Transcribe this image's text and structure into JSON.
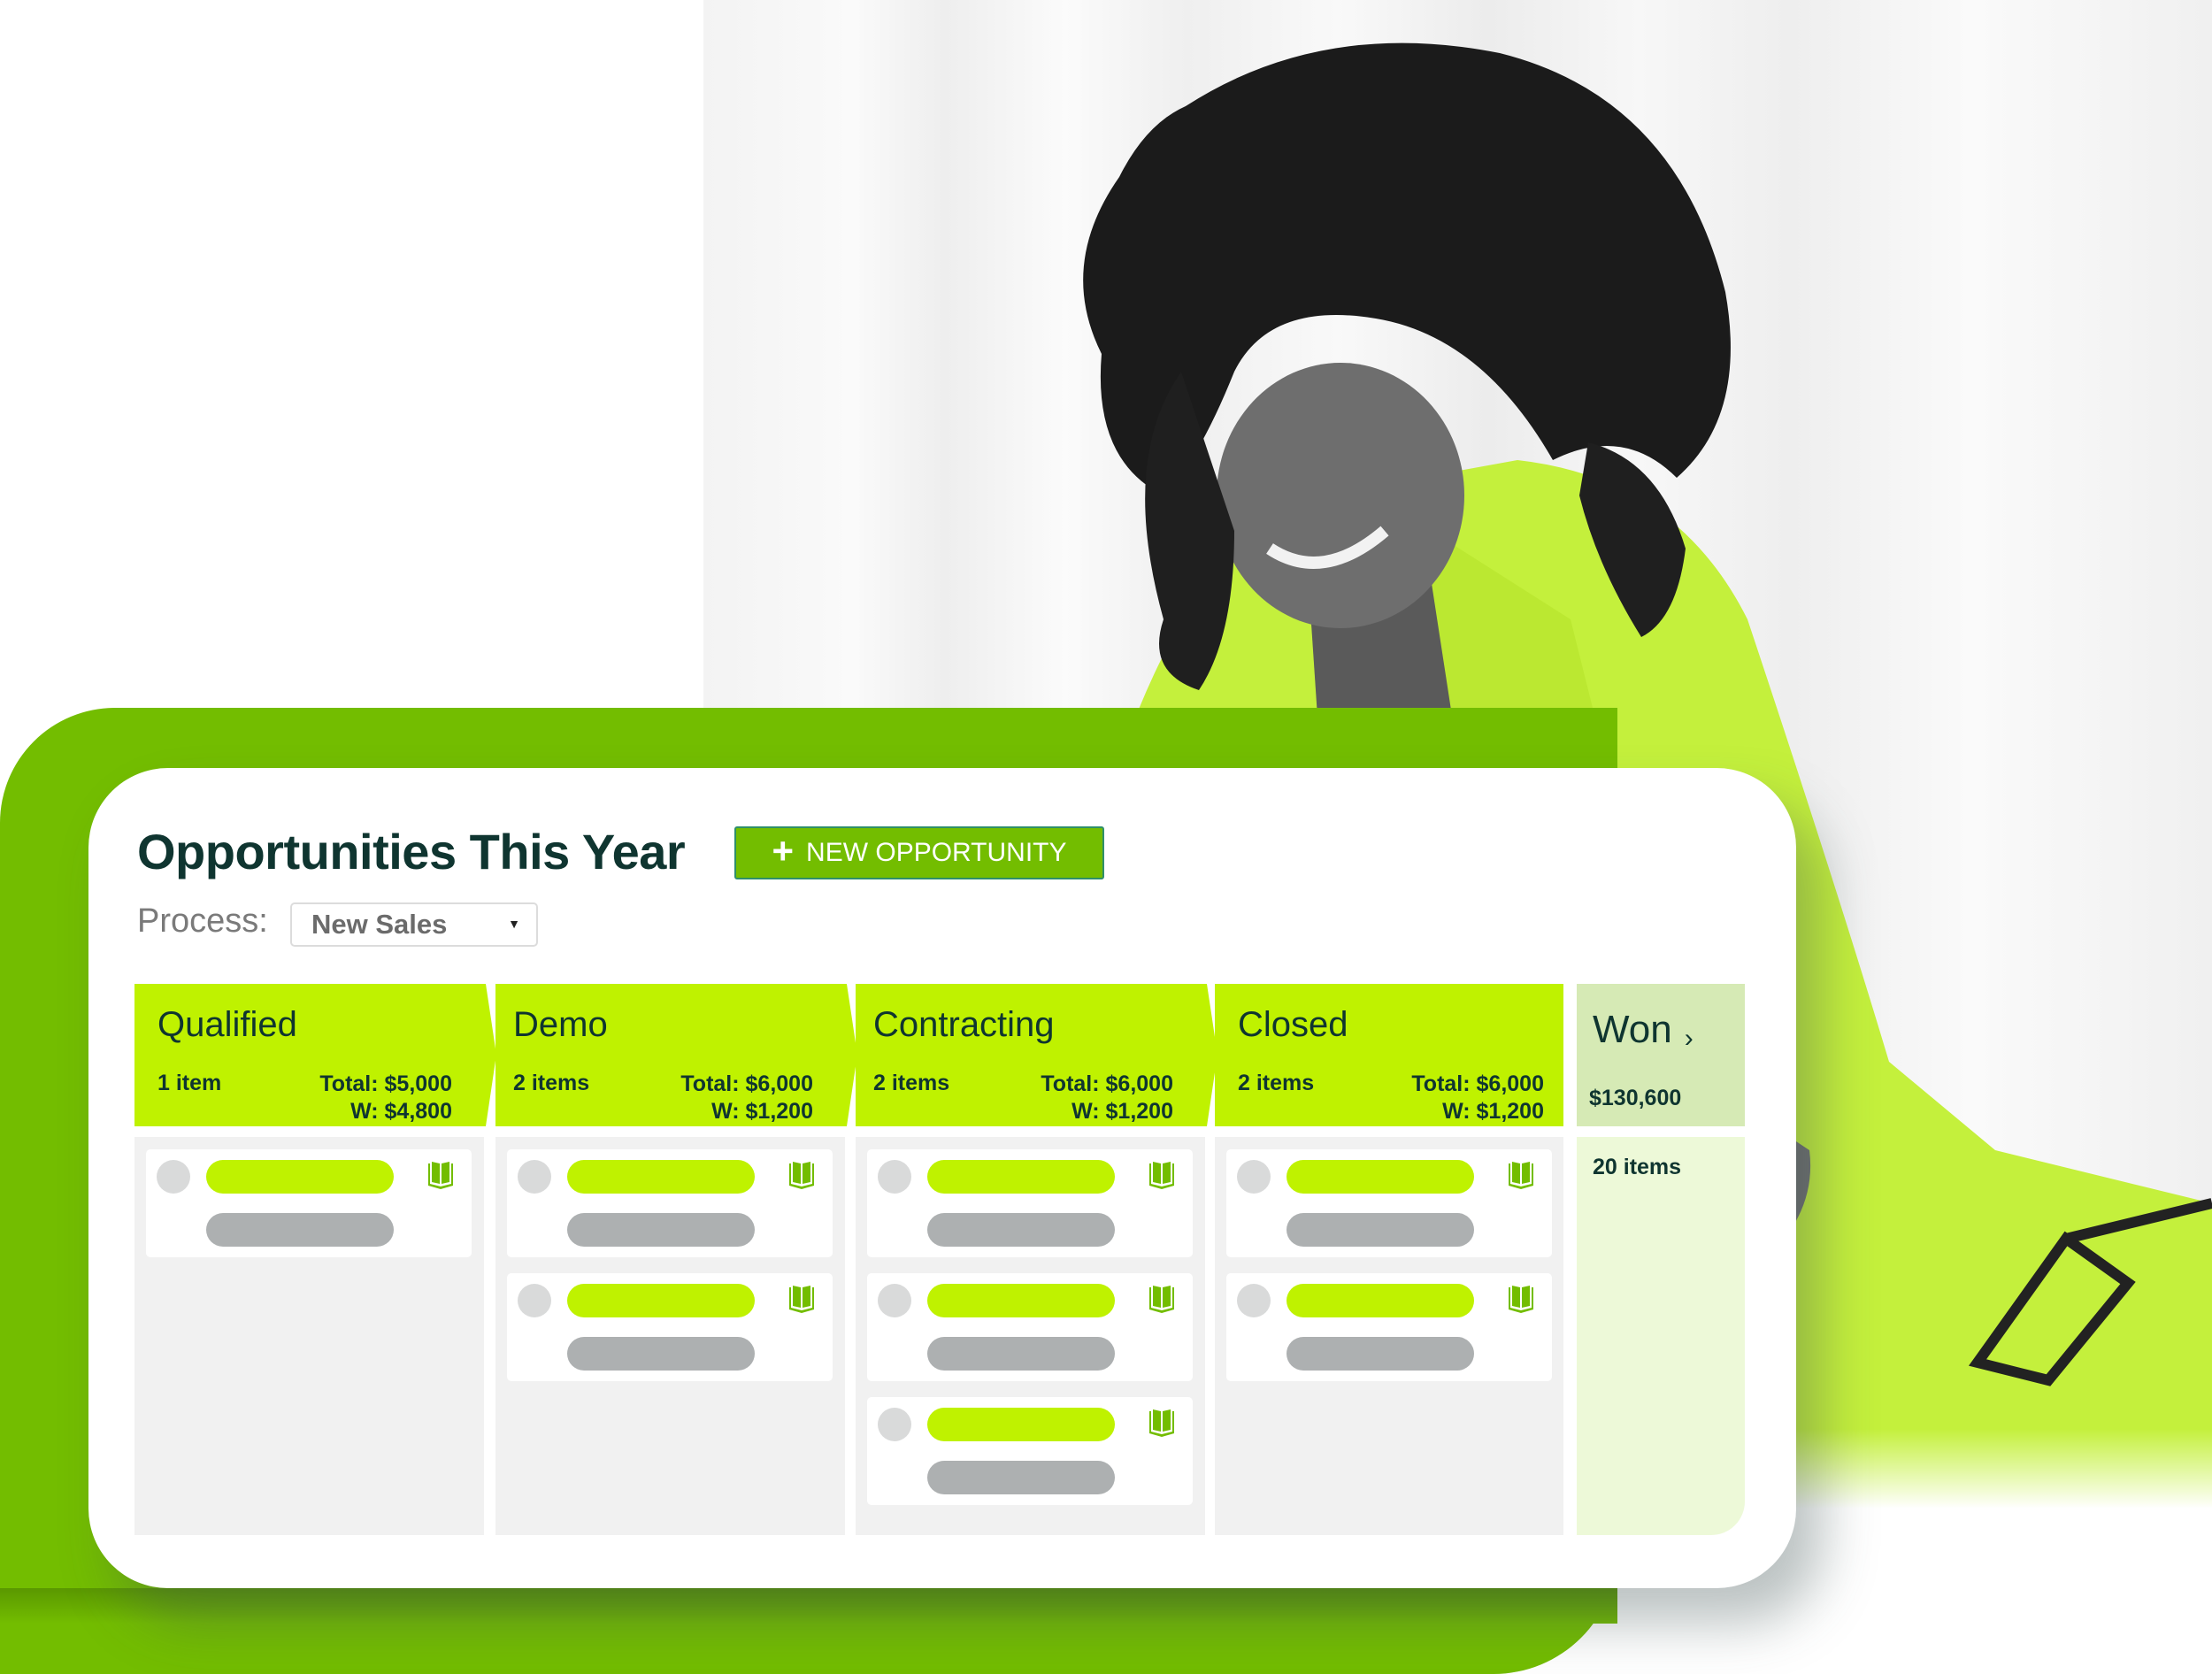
{
  "board": {
    "title": "Opportunities This Year",
    "new_button_label": "NEW OPPORTUNITY",
    "new_button_icon": "plus-icon",
    "process_label": "Process:",
    "process_value": "New Sales",
    "process_caret": "▾"
  },
  "stages": [
    {
      "name": "Qualified",
      "count": "1 item",
      "total": "Total: $5,000",
      "weighted": "W: $4,800",
      "cards": 1
    },
    {
      "name": "Demo",
      "count": "2 items",
      "total": "Total: $6,000",
      "weighted": "W: $1,200",
      "cards": 2
    },
    {
      "name": "Contracting",
      "count": "2 items",
      "total": "Total: $6,000",
      "weighted": "W: $1,200",
      "cards": 3
    },
    {
      "name": "Closed",
      "count": "2 items",
      "total": "Total: $6,000",
      "weighted": "W: $1,200",
      "cards": 2
    }
  ],
  "won": {
    "name": "Won",
    "arrow": "›",
    "amount": "$130,600",
    "count": "20 items"
  },
  "card_icon": "book-icon",
  "colors": {
    "brand_green": "#73bd00",
    "stage_lime": "#bff200",
    "won_header": "#d6eab5",
    "won_body": "#edf9d8",
    "title_text": "#0f3530",
    "placeholder_gray": "#adb0b1"
  }
}
